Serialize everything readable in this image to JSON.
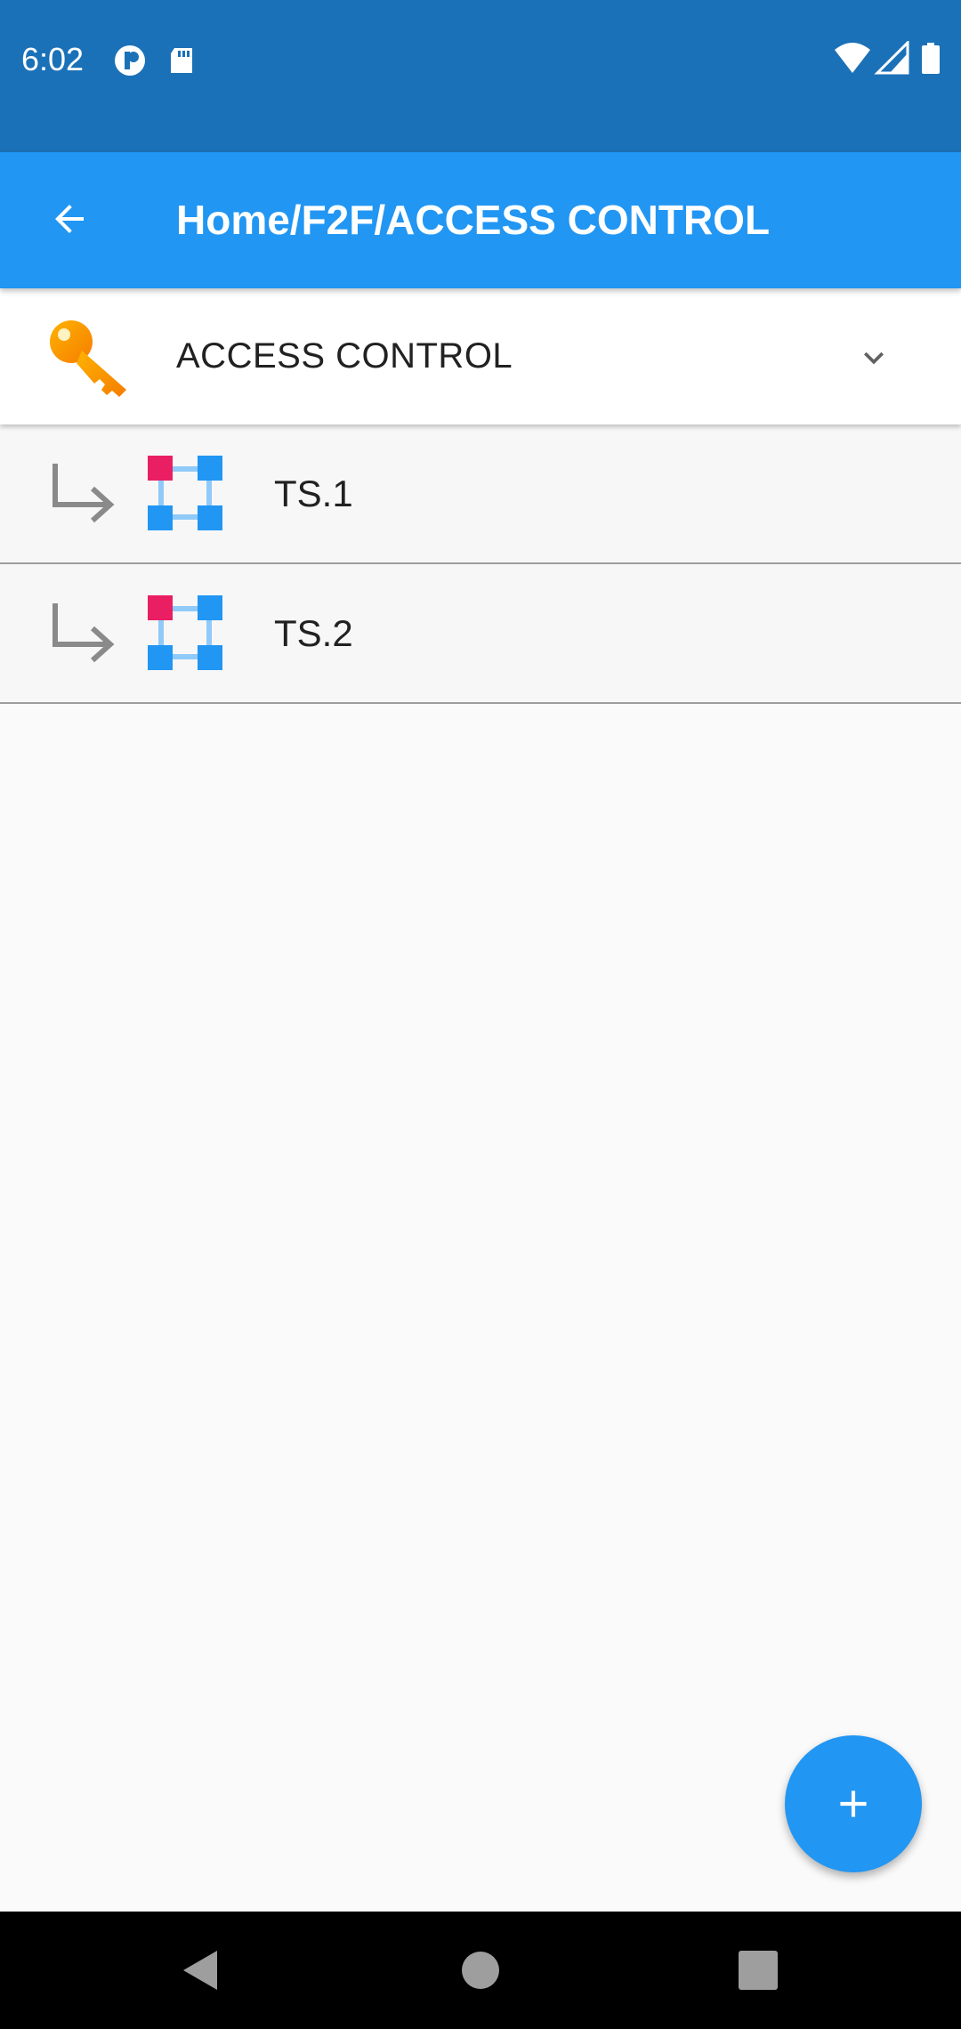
{
  "status_bar": {
    "time": "6:02",
    "left_icons": [
      "notification-app-icon",
      "sd-card-icon"
    ],
    "right_icons": [
      "wifi-icon",
      "signal-icon",
      "battery-icon"
    ]
  },
  "app_bar": {
    "title": "Home/F2F/ACCESS CONTROL",
    "back_icon": "arrow-back-icon",
    "color": "#2196f3"
  },
  "header": {
    "label": "ACCESS CONTROL",
    "icon": "key-icon",
    "expand_icon": "chevron-down-icon"
  },
  "items": [
    {
      "label": "TS.1",
      "icon": "network-nodes-icon",
      "indent_icon": "subdirectory-arrow-icon"
    },
    {
      "label": "TS.2",
      "icon": "network-nodes-icon",
      "indent_icon": "subdirectory-arrow-icon"
    }
  ],
  "fab": {
    "icon": "plus-icon",
    "color": "#2196f3"
  },
  "nav_bar": {
    "buttons": [
      "back-triangle-icon",
      "home-circle-icon",
      "recents-square-icon"
    ]
  }
}
